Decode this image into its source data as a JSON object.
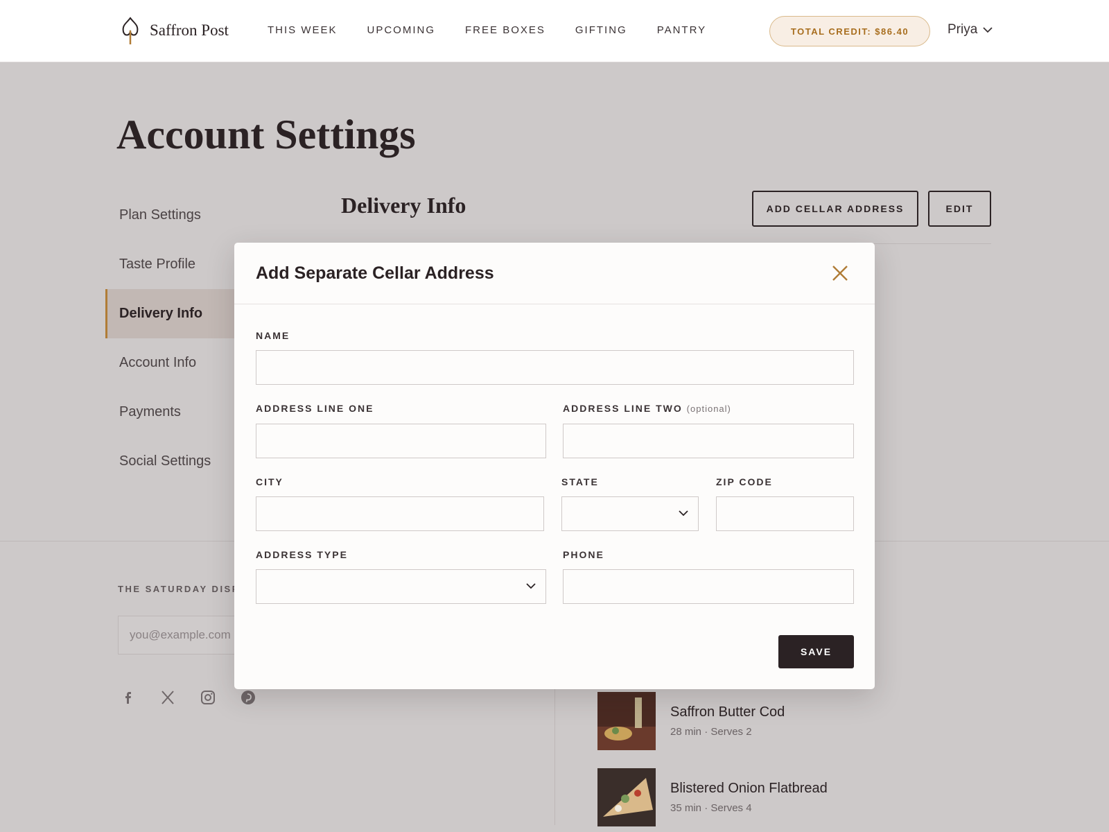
{
  "header": {
    "brand": "Saffron Post",
    "nav": [
      "THIS WEEK",
      "UPCOMING",
      "FREE BOXES",
      "GIFTING",
      "PANTRY"
    ],
    "credit": "TOTAL CREDIT: $86.40",
    "user": "Priya"
  },
  "page": {
    "title": "Account Settings",
    "sidebar": [
      "Plan Settings",
      "Taste Profile",
      "Delivery Info",
      "Account Info",
      "Payments",
      "Social Settings"
    ],
    "active_item": "Delivery Info",
    "section_title": "Delivery Info",
    "add_cellar_label": "ADD CELLAR ADDRESS",
    "edit_label": "EDIT"
  },
  "footer": {
    "newsletter_label": "THE SATURDAY DISP",
    "newsletter_placeholder": "you@example.com",
    "socials": [
      "facebook-icon",
      "x-icon",
      "instagram-icon",
      "pinterest-icon"
    ],
    "recipes": [
      {
        "name": "Saffron Butter Cod",
        "meta": "28 min · Serves 2"
      },
      {
        "name": "Blistered Onion Flatbread",
        "meta": "35 min · Serves 4"
      }
    ]
  },
  "modal": {
    "title": "Add Separate Cellar Address",
    "labels": {
      "name": "NAME",
      "address_one": "ADDRESS LINE ONE",
      "address_two": "ADDRESS LINE TWO",
      "address_two_optional": "(optional)",
      "city": "CITY",
      "state": "STATE",
      "zip": "ZIP CODE",
      "address_type": "ADDRESS TYPE",
      "phone": "PHONE"
    },
    "values": {
      "name": "",
      "address_one": "",
      "address_two": "",
      "city": "",
      "state": "",
      "zip": "",
      "address_type": "",
      "phone": ""
    },
    "save_label": "SAVE"
  },
  "colors": {
    "accent": "#b07c36",
    "dark": "#2b2224",
    "overlay_bg": "#cdc9c9",
    "credit_bg": "#f8eee4"
  }
}
